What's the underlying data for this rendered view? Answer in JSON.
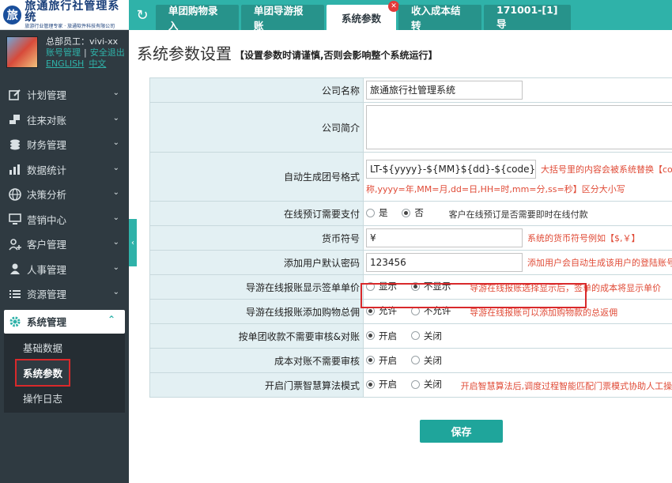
{
  "app": {
    "title": "旅通旅行社管理系统",
    "subtitle": "旅游行业管理专家 · 旅通软件科技有限公司"
  },
  "user": {
    "name": "总部员工：vivi-xx",
    "account": "账号管理",
    "logout": "安全退出",
    "lang_en": "ENGLISH",
    "lang_cn": "中文"
  },
  "menu": [
    {
      "label": "计划管理",
      "icon": "edit-icon"
    },
    {
      "label": "往来对账",
      "icon": "money-hand-icon"
    },
    {
      "label": "财务管理",
      "icon": "coins-icon"
    },
    {
      "label": "数据统计",
      "icon": "chart-icon"
    },
    {
      "label": "决策分析",
      "icon": "globe-icon"
    },
    {
      "label": "营销中心",
      "icon": "monitor-icon"
    },
    {
      "label": "客户管理",
      "icon": "user-add-icon"
    },
    {
      "label": "人事管理",
      "icon": "person-icon"
    },
    {
      "label": "资源管理",
      "icon": "list-icon"
    }
  ],
  "active_menu": {
    "label": "系统管理",
    "subitems": [
      "基础数据",
      "系统参数",
      "操作日志"
    ],
    "selected": "系统参数"
  },
  "tabs": [
    {
      "label": "单团购物录入"
    },
    {
      "label": "单团导游报账"
    },
    {
      "label": "系统参数",
      "active": true
    },
    {
      "label": "收入成本结转"
    },
    {
      "label": "171001-[1]导"
    }
  ],
  "page": {
    "title": "系统参数设置",
    "note": "【设置参数时请谨慎,否则会影响整个系统运行】"
  },
  "form": {
    "company_name": {
      "label": "公司名称",
      "value": "旅通旅行社管理系统"
    },
    "company_intro": {
      "label": "公司简介",
      "value": ""
    },
    "group_code": {
      "label": "自动生成团号格式",
      "value": "LT-${yyyy}-${MM}${dd}-${code}",
      "hint": "大括号里的内容会被系统替换【code",
      "hint2": "称,yyyy=年,MM=月,dd=日,HH=时,mm=分,ss=秒】区分大小写"
    },
    "online_pay": {
      "label": "在线预订需要支付",
      "opt_yes": "是",
      "opt_no": "否",
      "selected": "否",
      "hint": "客户在线预订是否需要即时在线付款"
    },
    "currency": {
      "label": "货币符号",
      "value": "¥",
      "hint": "系统的货币符号例如【$,￥】"
    },
    "default_pwd": {
      "label": "添加用户默认密码",
      "value": "123456",
      "hint": "添加用户会自动生成该用户的登陆账号"
    },
    "guide_sign_price": {
      "label": "导游在线报账显示签单单价",
      "opt_show": "显示",
      "opt_hide": "不显示",
      "selected": "不显示",
      "hint": "导游在线报账选择显示后，签单的成本将显示单价"
    },
    "guide_shopping": {
      "label": "导游在线报账添加购物总佣",
      "opt_allow": "允许",
      "opt_deny": "不允许",
      "selected": "允许",
      "hint": "导游在线报账可以添加购物款的总返佣"
    },
    "group_receipt": {
      "label": "按单团收款不需要审核&对账",
      "opt_on": "开启",
      "opt_off": "关闭",
      "selected": "开启"
    },
    "cost_reconcile": {
      "label": "成本对账不需要审核",
      "opt_on": "开启",
      "opt_off": "关闭",
      "selected": "开启"
    },
    "ticket_algo": {
      "label": "开启门票智慧算法模式",
      "opt_on": "开启",
      "opt_off": "关闭",
      "selected": "开启",
      "hint": "开启智慧算法后,调度过程智能匹配门票模式协助人工操作"
    }
  },
  "save_label": "保存",
  "colors": {
    "accent": "#2fb2a9",
    "sidebar": "#2f3a41",
    "label_bg": "#e3f0f3",
    "hint": "#e04b37",
    "highlight": "#d9292b"
  }
}
